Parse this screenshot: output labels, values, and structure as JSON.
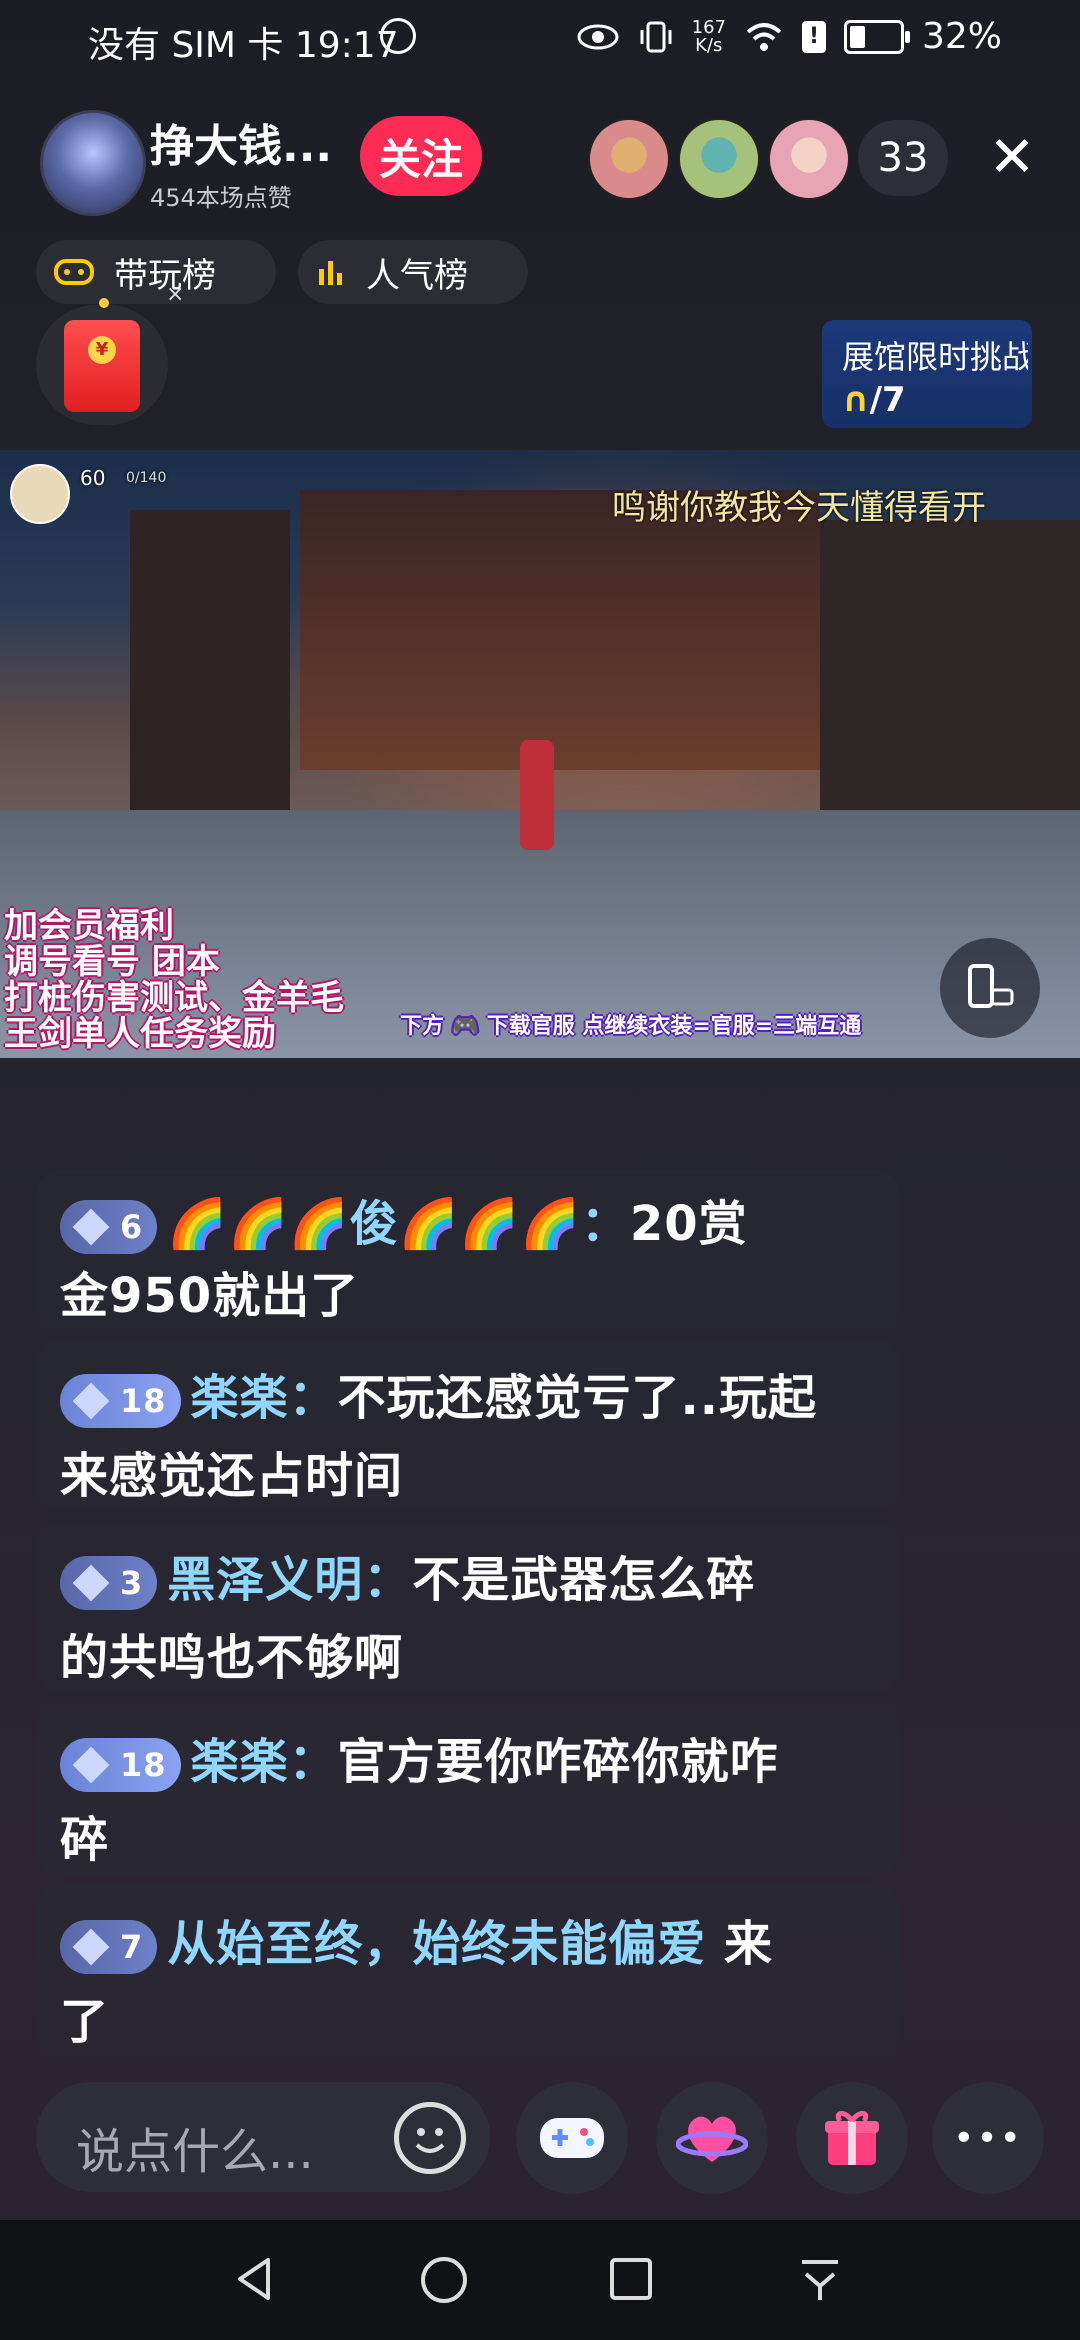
{
  "status_bar": {
    "carrier_time": "没有 SIM 卡 19:17",
    "speed_top": "167",
    "speed_bottom": "K/s",
    "battery": "32%",
    "battery_level": 0.32
  },
  "header": {
    "streamer_name": "挣大钱...",
    "likes_text": "454本场点赞",
    "follow_label": "关注",
    "viewer_count": "33",
    "close_glyph": "✕"
  },
  "rank_pills": {
    "play_rank": "带玩榜",
    "popularity_rank": "人气榜"
  },
  "red_packet": {
    "close_glyph": "×",
    "coin_glyph": "¥"
  },
  "event": {
    "title": "展馆限时挑战",
    "progress_label": "0/7",
    "progress_value": 0,
    "progress_total": 7
  },
  "video": {
    "subtitle": "鸣谢你教我今天懂得看开",
    "overlay_lines": [
      "加会员福利",
      "调号看号 团本",
      "打桩伤害测试、金羊毛",
      "王剑单人任务奖励"
    ],
    "bottom_banner": "下方 🎮 下载官服 点继续衣装=官服=三端互通",
    "hud_level": "60",
    "hud_exp": "0/140"
  },
  "chat": [
    {
      "level": "6",
      "user": "🌈🌈🌈俊🌈🌈🌈：",
      "line1_text": "20赏",
      "line2": "金950就出了"
    },
    {
      "level": "18",
      "user": "楽楽：",
      "line1_text": "不玩还感觉亏了..玩起",
      "line2": "来感觉还占时间"
    },
    {
      "level": "3",
      "user": "黑泽义明：",
      "line1_text": "不是武器怎么碎",
      "line2": "的共鸣也不够啊"
    },
    {
      "level": "18",
      "user": "楽楽：",
      "line1_text": "官方要你咋碎你就咋",
      "line2": "碎"
    },
    {
      "level": "7",
      "user": "从始至终，始终未能偏爱",
      "line1_text": " 来",
      "line2": "了"
    }
  ],
  "bottom_bar": {
    "input_placeholder": "说点什么...",
    "more_glyph": "•••"
  },
  "icons": [
    "eye-icon",
    "vibrate-icon",
    "wifi-icon",
    "battery-icon",
    "gamepad-icon",
    "bar-chart-icon",
    "emoji-icon",
    "heart-planet-icon",
    "gift-icon",
    "more-icon",
    "back-icon",
    "home-icon",
    "recents-icon",
    "download-icon",
    "rotate-screen-icon"
  ],
  "colors": {
    "follow": "#fe2c55",
    "username": "#8fd7ff",
    "event_bg": "#1c3a7a",
    "accent_yellow": "#ffd23a"
  }
}
